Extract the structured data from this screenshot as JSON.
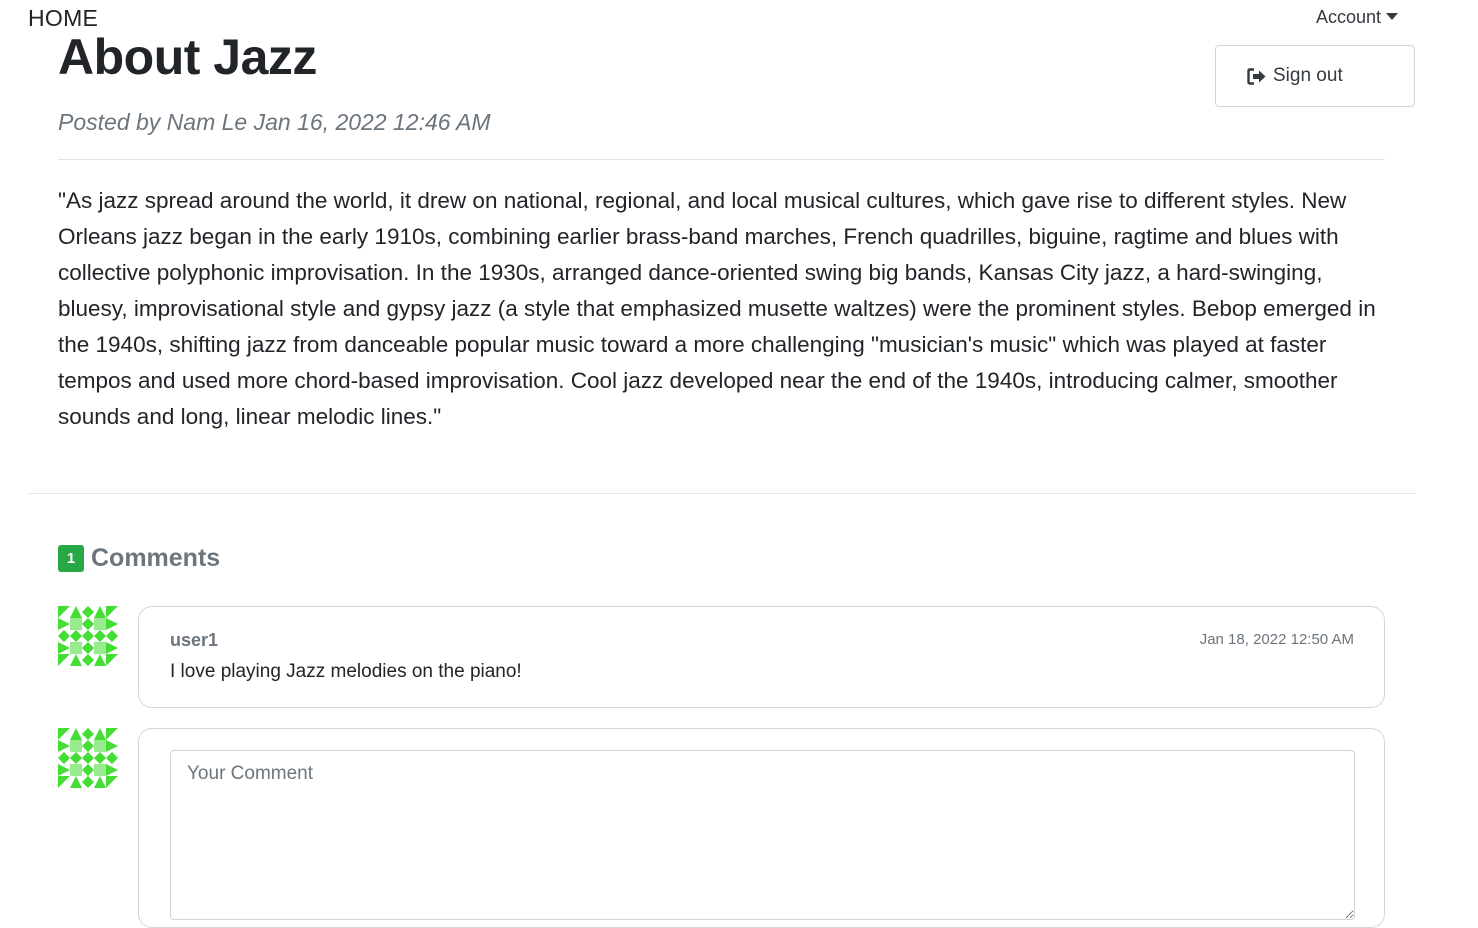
{
  "nav": {
    "home_label": "HOME",
    "account_label": "Account",
    "signout_label": "Sign out",
    "signout_icon": "sign-out-icon"
  },
  "post": {
    "title": "About Jazz",
    "meta": "Posted by Nam Le Jan 16, 2022 12:46 AM",
    "body": "\"As jazz spread around the world, it drew on national, regional, and local musical cultures, which gave rise to different styles. New Orleans jazz began in the early 1910s, combining earlier brass-band marches, French quadrilles, biguine, ragtime and blues with collective polyphonic improvisation. In the 1930s, arranged dance-oriented swing big bands, Kansas City jazz, a hard-swinging, bluesy, improvisational style and gypsy jazz (a style that emphasized musette waltzes) were the prominent styles. Bebop emerged in the 1940s, shifting jazz from danceable popular music toward a more challenging \"musician's music\" which was played at faster tempos and used more chord-based improvisation. Cool jazz developed near the end of the 1940s, introducing calmer, smoother sounds and long, linear melodic lines.\""
  },
  "comments": {
    "count": "1",
    "heading": "Comments",
    "items": [
      {
        "user": "user1",
        "date": "Jan 18, 2022 12:50 AM",
        "text": "I love playing Jazz melodies on the piano!"
      }
    ],
    "input_placeholder": "Your Comment"
  },
  "colors": {
    "badge": "#28a745",
    "avatar_green": "#44dd33",
    "muted_text": "#6c757d",
    "border": "#d3d6d9"
  }
}
